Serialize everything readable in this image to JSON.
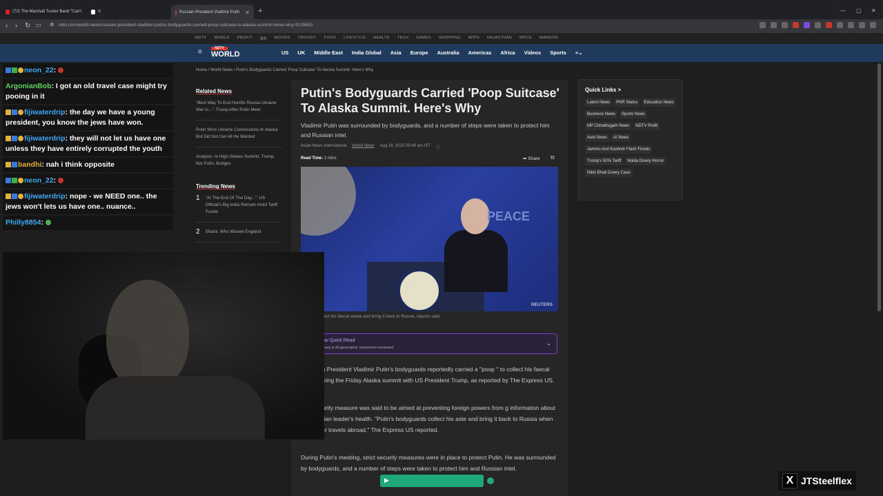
{
  "browser": {
    "tabs": [
      {
        "label": "(72) The Marshall Tucker Band \"Can't",
        "active": false
      },
      {
        "label": "X",
        "active": false
      },
      {
        "label": "Russian President Vladimir Putin",
        "active": true
      }
    ],
    "url": "ndtv.com/world-news/russian-president-vladimir-putins-bodyguards-carried-poop-suitcase-to-alaska-summit-heres-why-9105653"
  },
  "site": {
    "top_links": [
      "NDTV",
      "WORLD",
      "PROFIT",
      "हिंदी",
      "MOVIES",
      "CRICKET",
      "FOOD",
      "LIFESTYLE",
      "HEALTH",
      "TECH",
      "GAMES",
      "SHOPPING",
      "APPS",
      "RAJASTHAN",
      "MPCG",
      "MARATHI"
    ],
    "logo": "NDTV WORLD",
    "nav": [
      "US",
      "UK",
      "Middle East",
      "India Global",
      "Asia",
      "Europe",
      "Australia",
      "Americas",
      "Africa",
      "Videos",
      "Sports"
    ],
    "breadcrumbs": "Home / World News / Putin's Bodyguards Carried 'Poop Suitcase' To Alaska Summit. Here's Why"
  },
  "related": {
    "title": "Related News",
    "items": [
      "\"Best Way To End Horrific Russia-Ukraine War Is...\": Trump After Putin Meet",
      "Putin Wins Ukraine Concessions In Alaska But Did Not Get All He Wanted",
      "Analysis: In High-Stakes Summit, Trump, Not Putin, Budges"
    ]
  },
  "trending": {
    "title": "Trending News",
    "items": [
      {
        "num": "1",
        "text": "\"At The End Of The Day...\": US Official's Big India Remark Amid Tariff Tussle"
      },
      {
        "num": "2",
        "text": "Shami, Who Missed England"
      }
    ]
  },
  "article": {
    "headline": "Putin's Bodyguards Carried 'Poop Suitcase' To Alaska Summit. Here's Why",
    "deck": "Vladimir Putin was surrounded by bodyguards, and a number of steps were taken to protect him and Russian intel.",
    "source": "Asian News International",
    "category": "World News",
    "date": "Aug 18, 2025 09:49 am IST",
    "read_time_label": "Read Time:",
    "read_time": "2 mins",
    "share": "Share",
    "photo_credit": "REUTERS",
    "photo_text": "PEACE",
    "caption": "yguards collect his faecal waste and bring it back to Russia, reports said.",
    "quick_read_title": "ow Quick Read",
    "quick_read_sub": "mary is AI-generated, newsroom-reviewed",
    "paragraphs": [
      ": Russian President Vladimir Putin's bodyguards reportedly carried a \"poop \" to collect his faecal waste during the Friday Alaska summit with US President Trump, as reported by The Express US.",
      "sual security measure was said to be aimed at preventing foreign powers from g information about the Russian leader's health. \"Putin's bodyguards collect his aste and bring it back to Russia when the leader travels abroad,\" The Express US reported.",
      "During Putin's meeting, strict security measures were in place to protect Putin. He was surrounded by bodyguards, and a number of steps were taken to protect him and Russian intel."
    ]
  },
  "quick_links": {
    "title": "Quick Links >",
    "tags": [
      "Latest News",
      "PNR Status",
      "Education News",
      "Business News",
      "Sports News",
      "MP Chhattisgarh News",
      "NDTV Profit",
      "Auto News",
      "AI News",
      "Jammu And Kashmir Flash Floods",
      "Trump's 50% Tariff",
      "Noida Dowry Horror",
      "Nikki Bhati Dowry Case"
    ]
  },
  "chat": [
    {
      "badges": [
        "b",
        "g",
        "y"
      ],
      "badge_num": "",
      "user": "neon_22",
      "color": "#3fa9f5",
      "text": "",
      "emote": "r"
    },
    {
      "badges": [],
      "badge_num": "",
      "user": "ArgonianBob",
      "color": "#5fd35f",
      "text": "I got an old travel case might try pooing in it",
      "emote": ""
    },
    {
      "badges": [
        "w",
        "b",
        "y"
      ],
      "badge_num": "",
      "user": "fijiwaterdrip",
      "color": "#3fa9f5",
      "text": "the day we have a young president, you know the jews have won.",
      "emote": ""
    },
    {
      "badges": [
        "w",
        "b",
        "y"
      ],
      "badge_num": "",
      "user": "fijiwaterdrip",
      "color": "#3fa9f5",
      "text": "they will not let us have one unless they have entirely corrupted the youth",
      "emote": ""
    },
    {
      "badges": [
        "w",
        "b"
      ],
      "badge_num": "",
      "user": "bandhi",
      "color": "#e2b23a",
      "text": "nah i think opposite",
      "emote": ""
    },
    {
      "badges": [
        "b",
        "g",
        "y"
      ],
      "badge_num": "",
      "user": "neon_22",
      "color": "#3fa9f5",
      "text": "",
      "emote": "r"
    },
    {
      "badges": [
        "w",
        "b",
        "y"
      ],
      "badge_num": "",
      "user": "fijiwaterdrip",
      "color": "#3fa9f5",
      "text": "nope - we NEED one.. the jews won't lets us have one.. nuance..",
      "emote": ""
    },
    {
      "badges": [],
      "badge_num": "",
      "user": "Philly8854",
      "color": "#3fa9f5",
      "text": "",
      "emote": "gr"
    }
  ],
  "streamer": {
    "handle": "JTSteelflex",
    "logo_icon": "x-logo-icon"
  }
}
